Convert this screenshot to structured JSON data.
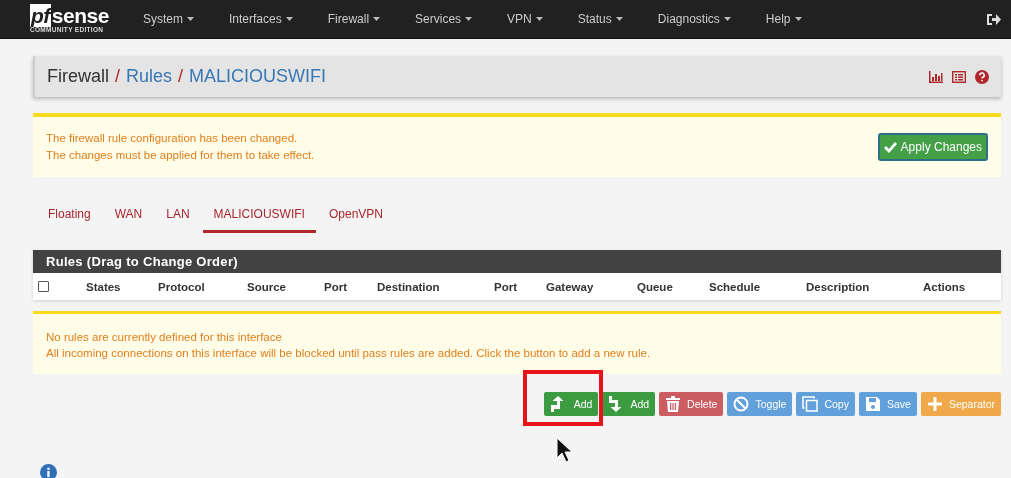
{
  "navbar": {
    "logo": {
      "brand_left": "pf",
      "brand_right": "sense",
      "edition": "COMMUNITY EDITION"
    },
    "menus": [
      "System",
      "Interfaces",
      "Firewall",
      "Services",
      "VPN",
      "Status",
      "Diagnostics",
      "Help"
    ]
  },
  "breadcrumb": [
    {
      "label": "Firewall",
      "separator": "/"
    },
    {
      "label": "Rules",
      "separator": "/"
    },
    {
      "label": "MALICIOUSWIFI"
    }
  ],
  "alert": {
    "lines": [
      "The firewall rule configuration has been changed.",
      "The changes must be applied for them to take effect."
    ],
    "button": "Apply Changes"
  },
  "tabs": [
    {
      "label": "Floating",
      "selected": false
    },
    {
      "label": "WAN",
      "selected": false
    },
    {
      "label": "LAN",
      "selected": false
    },
    {
      "label": "MALICIOUSWIFI",
      "selected": true
    },
    {
      "label": "OpenVPN",
      "selected": false
    }
  ],
  "rules_table": {
    "title": "Rules (Drag to Change Order)",
    "select_all_checked": false,
    "columns": [
      "States",
      "Protocol",
      "Source",
      "Port",
      "Destination",
      "Port",
      "Gateway",
      "Queue",
      "Schedule",
      "Description",
      "Actions"
    ]
  },
  "notice": {
    "lines": [
      "No rules are currently defined for this interface",
      "All incoming connections on this interface will be blocked until pass rules are added. Click the button to add a new rule."
    ]
  },
  "actions": [
    {
      "kind": "add-top",
      "label": "Add"
    },
    {
      "kind": "add-bottom",
      "label": "Add"
    },
    {
      "kind": "delete",
      "label": "Delete"
    },
    {
      "kind": "toggle",
      "label": "Toggle"
    },
    {
      "kind": "copy",
      "label": "Copy"
    },
    {
      "kind": "save",
      "label": "Save"
    },
    {
      "kind": "separator",
      "label": "Separator"
    }
  ]
}
